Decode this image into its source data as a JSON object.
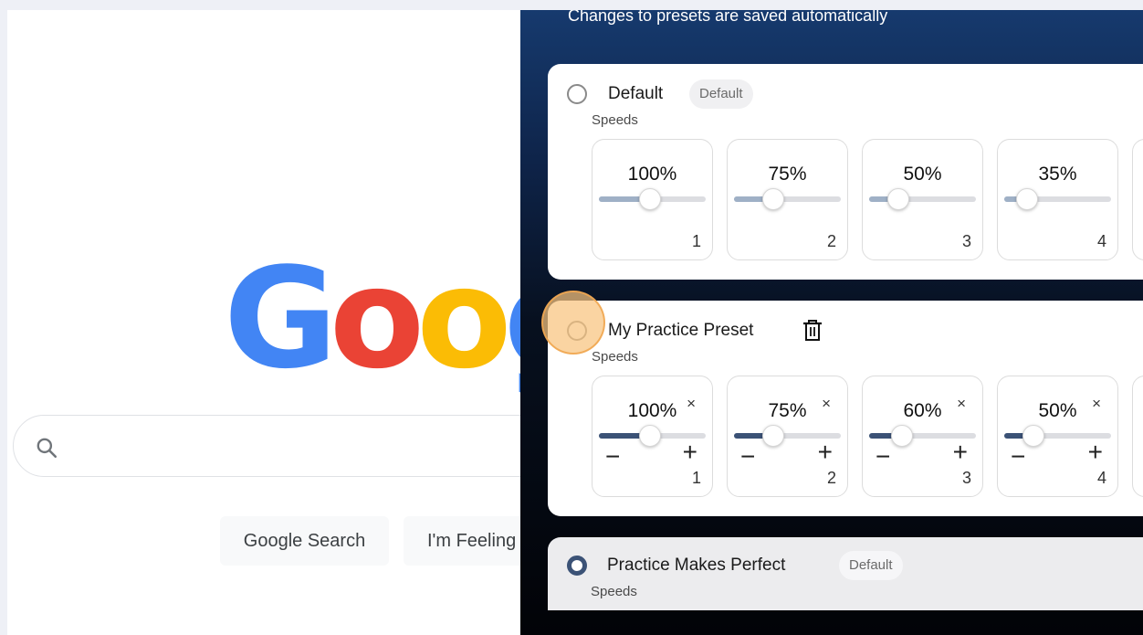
{
  "google": {
    "logo_letters": [
      "G",
      "o",
      "o",
      "g"
    ],
    "logo_colors": [
      "#4285F4",
      "#EA4335",
      "#FBBC05",
      "#4285F4"
    ],
    "search_icon": "search-icon",
    "search_button": "Google Search",
    "lucky_button": "I'm Feeling"
  },
  "panel": {
    "note": "Changes to presets are saved automatically",
    "presets": [
      {
        "name": "Default",
        "badge": "Default",
        "selected": false,
        "speeds_label": "Speeds",
        "speeds": [
          {
            "label": "100%",
            "index": "1",
            "level": 0.48
          },
          {
            "label": "75%",
            "index": "2",
            "level": 0.37
          },
          {
            "label": "50%",
            "index": "3",
            "level": 0.27
          },
          {
            "label": "35%",
            "index": "4",
            "level": 0.21
          }
        ]
      },
      {
        "name": "My Practice Preset",
        "selected": false,
        "delete_icon": "trash-icon",
        "speeds_label": "Speeds",
        "speeds": [
          {
            "label": "100%",
            "index": "1",
            "level": 0.48
          },
          {
            "label": "75%",
            "index": "2",
            "level": 0.37
          },
          {
            "label": "60%",
            "index": "3",
            "level": 0.31
          },
          {
            "label": "50%",
            "index": "4",
            "level": 0.27
          }
        ],
        "remove_glyph": "×",
        "minus_glyph": "−",
        "plus_glyph": "+"
      },
      {
        "name": "Practice Makes Perfect",
        "badge": "Default",
        "selected": true,
        "speeds_label": "Speeds"
      }
    ],
    "accent_color": "#3b5276"
  }
}
